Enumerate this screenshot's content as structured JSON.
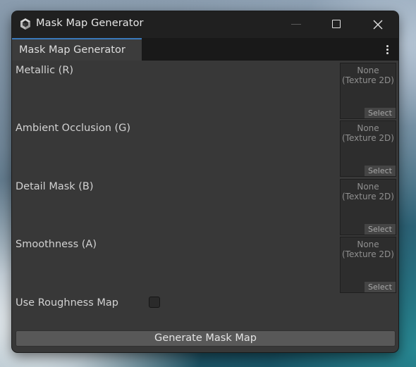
{
  "window": {
    "title": "Mask Map Generator",
    "icon": "unity-cube-icon",
    "controls": [
      "minimize-icon",
      "maximize-icon",
      "close-icon"
    ]
  },
  "tab": {
    "label": "Mask Map Generator",
    "accent_color": "#3a79bb"
  },
  "fields": [
    {
      "label": "Metallic (R)",
      "value_line1": "None",
      "value_line2": "(Texture 2D)",
      "button": "Select"
    },
    {
      "label": "Ambient Occlusion (G)",
      "value_line1": "None",
      "value_line2": "(Texture 2D)",
      "button": "Select"
    },
    {
      "label": "Detail Mask (B)",
      "value_line1": "None",
      "value_line2": "(Texture 2D)",
      "button": "Select"
    },
    {
      "label": "Smoothness (A)",
      "value_line1": "None",
      "value_line2": "(Texture 2D)",
      "button": "Select"
    }
  ],
  "toggle": {
    "label": "Use Roughness Map",
    "checked": false
  },
  "action": {
    "label": "Generate Mask Map"
  },
  "colors": {
    "panel": "#383838",
    "titlebar": "#202020",
    "tab_active": "#3c3c3c",
    "text": "#d2d2d2"
  }
}
